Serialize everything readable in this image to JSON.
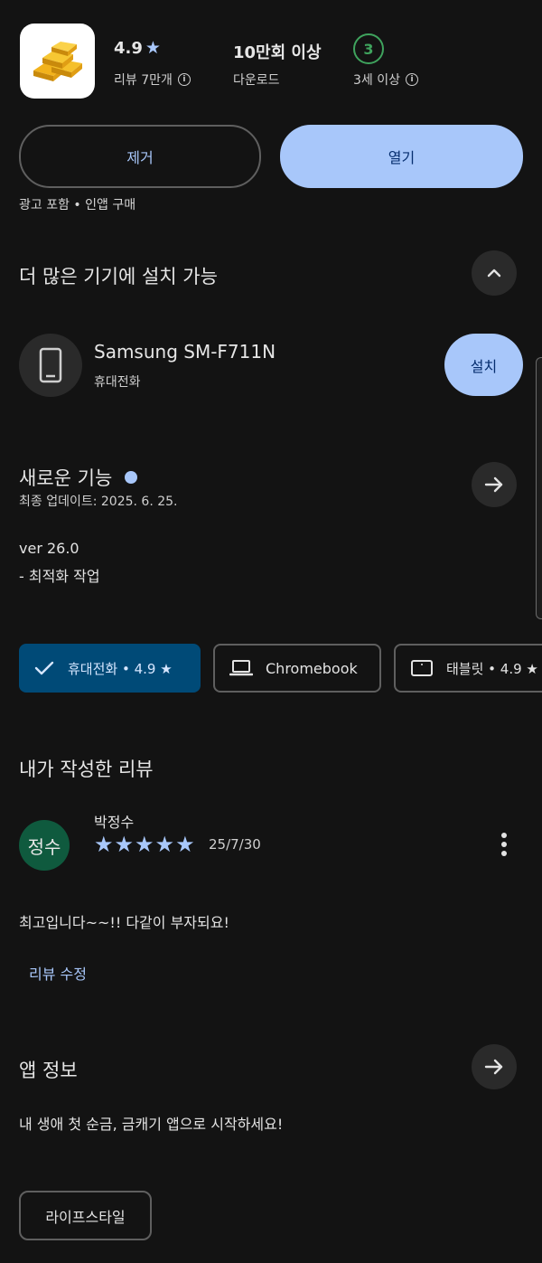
{
  "app": {
    "rating": "4.9",
    "rating_star": "★",
    "reviews": "리뷰 7만개",
    "downloads": "10만회 이상",
    "downloads_label": "다운로드",
    "age_rating": "3",
    "age_label": "3세 이상",
    "info_glyph": "i"
  },
  "buttons": {
    "uninstall": "제거",
    "open": "열기"
  },
  "notes": "광고 포함 • 인앱 구매",
  "more_devices": {
    "title": "더 많은 기기에 설치 가능",
    "device_name": "Samsung SM-F711N",
    "device_type": "휴대전화",
    "install": "설치"
  },
  "whats_new": {
    "title": "새로운 기능",
    "updated": "최종 업데이트: 2025. 6. 25.",
    "version": "ver 26.0",
    "note": "- 최적화 작업"
  },
  "device_tabs": [
    {
      "label": "휴대전화 • 4.9 ★",
      "icon": "check-icon",
      "selected": true
    },
    {
      "label": "Chromebook",
      "icon": "laptop-icon",
      "selected": false
    },
    {
      "label": "태블릿 • 4.9 ★",
      "icon": "tablet-icon",
      "selected": false
    }
  ],
  "my_review": {
    "title": "내가 작성한 리뷰",
    "avatar_text": "정수",
    "reviewer": "박정수",
    "stars": 5,
    "star_glyphs": "★★★★★",
    "date": "25/7/30",
    "text": "최고입니다~~!! 다같이 부자되요!",
    "edit": "리뷰 수정"
  },
  "app_info": {
    "title": "앱 정보",
    "description": "내 생애 첫 순금, 금캐기 앱으로 시작하세요!",
    "category": "라이프스타일"
  },
  "colors": {
    "background": "#131313",
    "accent": "#a8c7fa",
    "selected_chip": "#004a77",
    "avatar": "#0f5a3e",
    "age_badge": "#3fa35d"
  }
}
